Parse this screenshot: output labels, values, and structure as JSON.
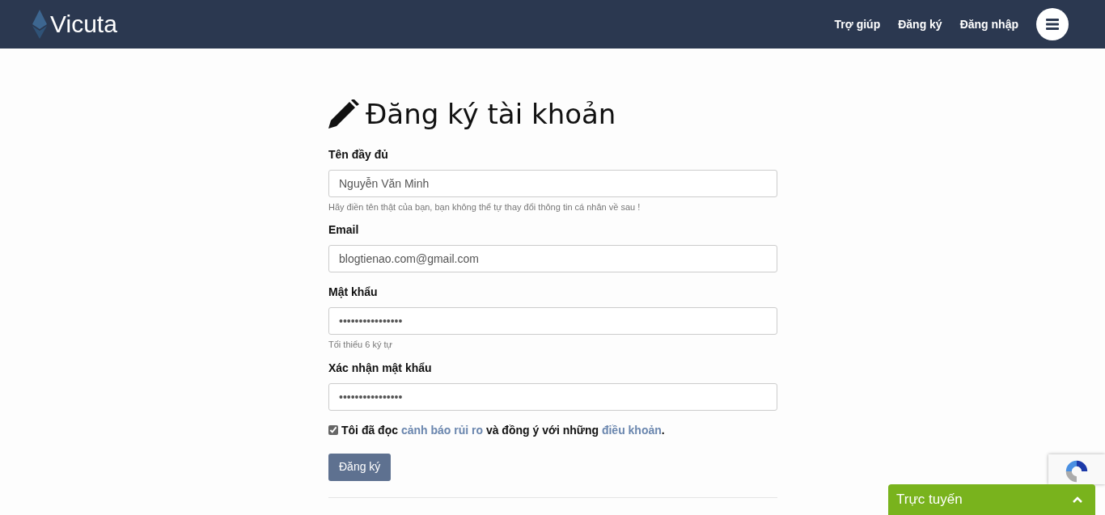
{
  "header": {
    "logo": "Vicuta",
    "nav": [
      "Trợ giúp",
      "Đăng ký",
      "Đăng nhập"
    ]
  },
  "title": "Đăng ký tài khoản",
  "fields": [
    {
      "label": "Tên đầy đủ",
      "value": "Nguyễn Văn Minh",
      "hint": "Hãy điền tên thật của bạn, bạn không thể tự thay đổi thông tin cá nhân về sau !"
    },
    {
      "label": "Email",
      "value": "blogtienao.com@gmail.com"
    },
    {
      "label": "Mật khẩu",
      "value": "••••••••••••••••",
      "hint": "Tối thiểu 6 ký tự"
    },
    {
      "label": "Xác nhận mật khẩu",
      "value": "••••••••••••••••"
    }
  ],
  "agree": {
    "checked": true,
    "parts": [
      {
        "kind": "text",
        "text": "Tôi đã đọc "
      },
      {
        "kind": "link",
        "text": "cảnh báo rủi ro"
      },
      {
        "kind": "text",
        "text": " và đồng ý với những "
      },
      {
        "kind": "link",
        "text": "điều khoản"
      },
      {
        "kind": "text",
        "text": "."
      }
    ]
  },
  "submit": "Đăng ký",
  "chat": {
    "label": "Trực tuyến",
    "expanded": false
  }
}
